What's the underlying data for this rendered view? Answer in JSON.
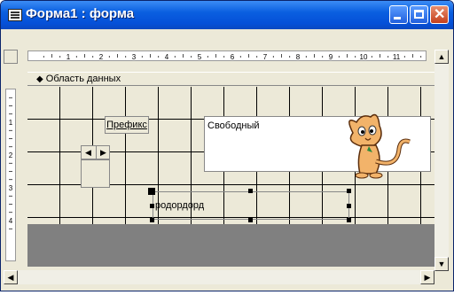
{
  "window": {
    "title": "Форма1 : форма"
  },
  "ruler": {
    "marks": [
      "1",
      "2",
      "3",
      "4",
      "5",
      "6",
      "7",
      "8",
      "9",
      "10",
      "11"
    ]
  },
  "vruler": {
    "marks": [
      "1",
      "2",
      "3",
      "4"
    ]
  },
  "section": {
    "label": "Область данных"
  },
  "controls": {
    "label_prefix": "Префикс",
    "textbox_value": "Свободный",
    "combo_value": "родордорд"
  },
  "colors": {
    "title_bar": "#0a5fe0",
    "section_bg": "#ece9d8",
    "grey_area": "#808080"
  }
}
